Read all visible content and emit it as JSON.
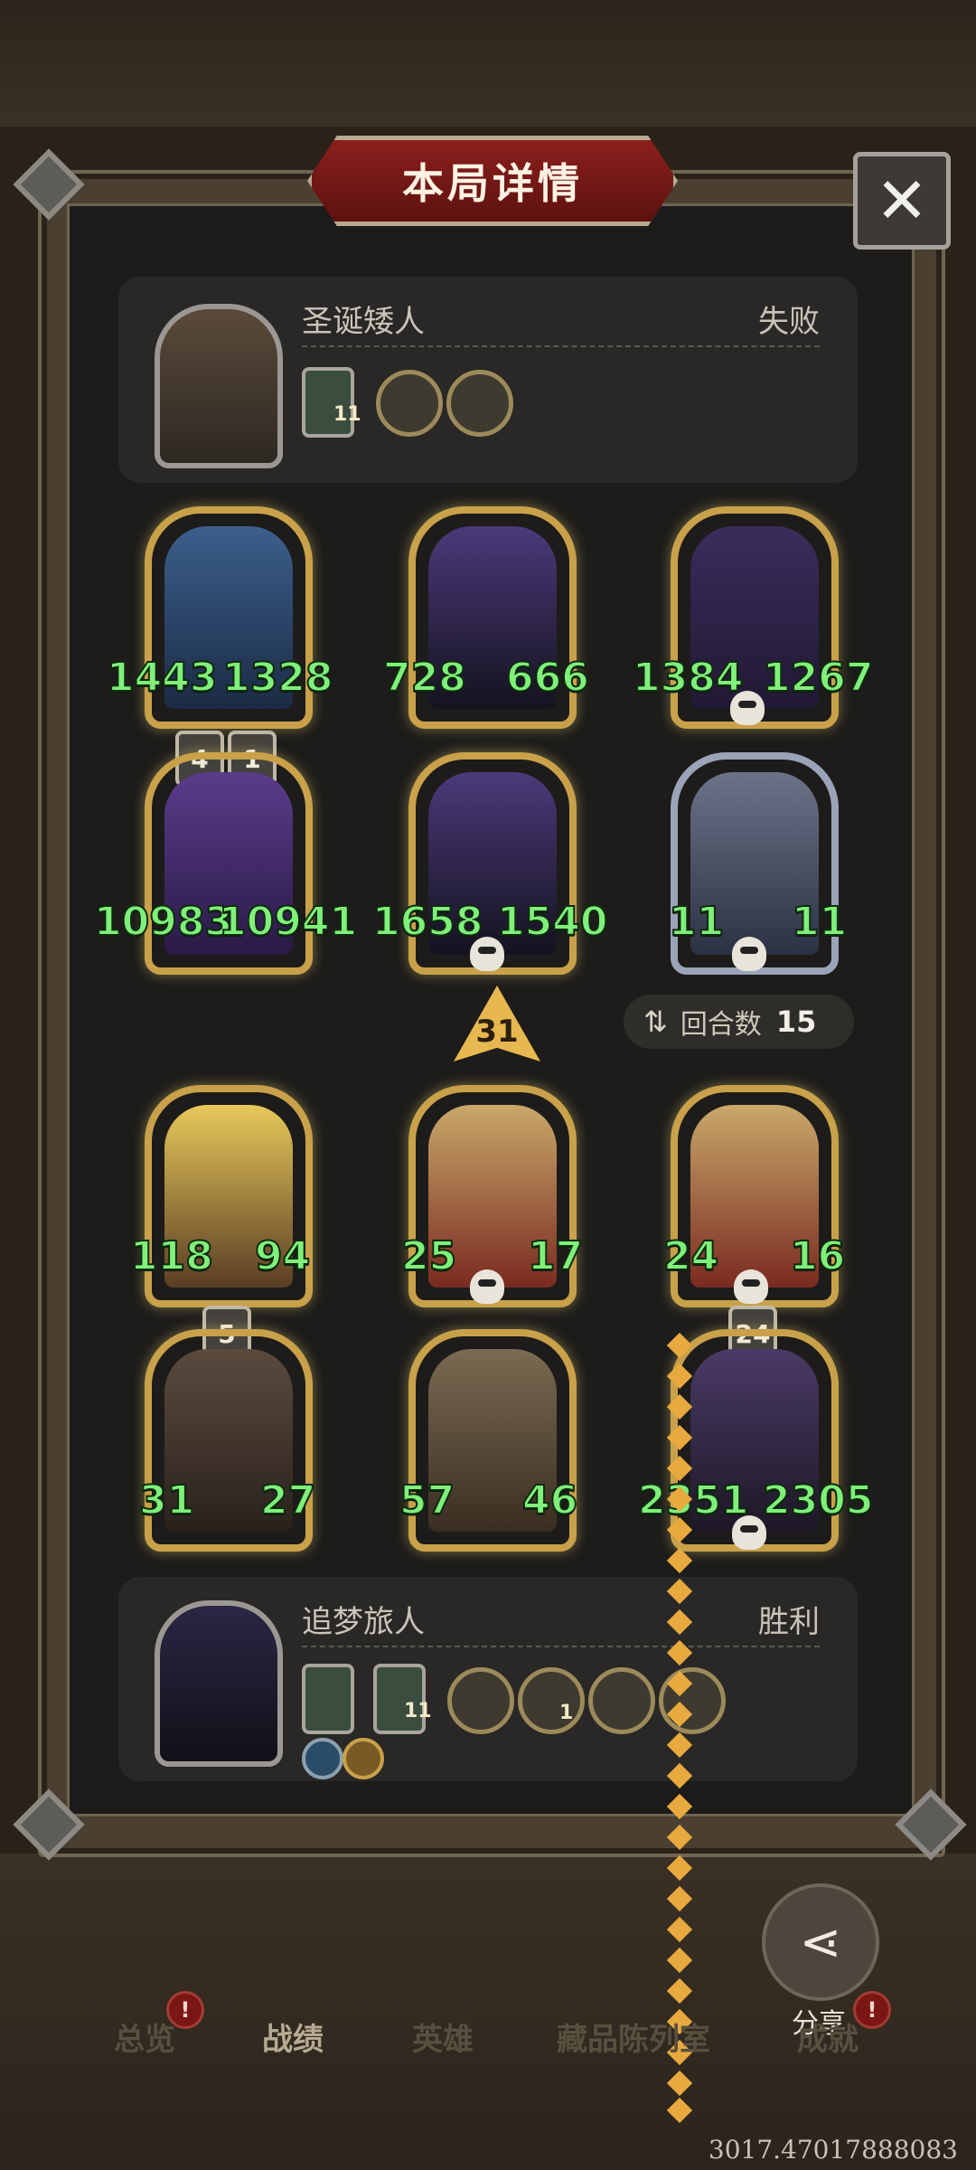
{
  "title": "本局详情",
  "close_icon": "close-x-icon",
  "top_player": {
    "name": "圣诞矮人",
    "result": "失败",
    "item_badge": "11"
  },
  "top_heroes": [
    {
      "attack": "1443",
      "health": "1328"
    },
    {
      "attack": "728",
      "health": "666"
    },
    {
      "attack": "1384",
      "health": "1267"
    },
    {
      "attack": "10983",
      "health": "10941"
    },
    {
      "attack": "1658",
      "health": "1540"
    },
    {
      "attack": "11",
      "health": "11"
    }
  ],
  "top_levels": [
    "4",
    "1"
  ],
  "arrow_value": "31",
  "round_label": "回合数",
  "round_value": "15",
  "bottom_heroes": [
    {
      "attack": "118",
      "health": "94"
    },
    {
      "attack": "25",
      "health": "17"
    },
    {
      "attack": "24",
      "health": "16"
    },
    {
      "attack": "31",
      "health": "27"
    },
    {
      "attack": "57",
      "health": "46"
    },
    {
      "attack": "2351",
      "health": "2305"
    }
  ],
  "bottom_levels": [
    "5",
    "24"
  ],
  "bottom_player": {
    "name": "追梦旅人",
    "result": "胜利",
    "item_badges": [
      "11",
      "1"
    ]
  },
  "share_label": "分享",
  "tabs": [
    "总览",
    "战绩",
    "英雄",
    "藏品陈列室",
    "成就"
  ],
  "active_tab": "战绩",
  "tab_alert": "!",
  "coords": "3017.47017888083",
  "colors": {
    "stat_green": "#7ff07a",
    "title_red": "#8b1f1c",
    "gold_frame": "#c9a14a"
  }
}
